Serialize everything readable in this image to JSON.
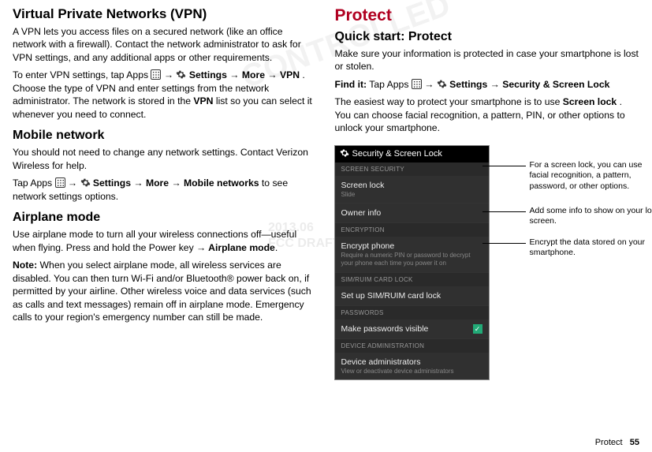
{
  "left": {
    "h_vpn": "Virtual Private Networks (VPN)",
    "p_vpn1": "A VPN lets you access files on a secured network (like an office network with a firewall). Contact the network administrator to ask for VPN settings, and any additional apps or other requirements.",
    "p_vpn2a": "To enter VPN settings, tap Apps ",
    "p_vpn2b": " Settings",
    "p_vpn2c": "More",
    "p_vpn2d": "VPN",
    "p_vpn2e": ". Choose the type of VPN and enter settings from the network administrator. The network is stored in the ",
    "p_vpn2f": "VPN",
    "p_vpn2g": " list so you can select it whenever you need to connect.",
    "h_mobile": "Mobile network",
    "p_mobile1": "You should not need to change any network settings. Contact Verizon Wireless for help.",
    "p_mobile2a": "Tap Apps ",
    "p_mobile2b": " Settings",
    "p_mobile2c": "More",
    "p_mobile2d": "Mobile networks",
    "p_mobile2e": " to see network settings options.",
    "h_airplane": "Airplane mode",
    "p_air1": "Use airplane mode to turn all your wireless connections off—useful when flying. Press and hold the Power key ",
    "p_air1b": "Airplane mode",
    "p_air2a": "Note:",
    "p_air2b": " When you select airplane mode, all wireless services are disabled. You can then turn Wi-Fi and/or Bluetooth® power back on, if permitted by your airline. Other wireless voice and data services (such as calls and text messages) remain off in airplane mode. Emergency calls to your region's emergency number can still be made."
  },
  "right": {
    "h_protect": "Protect",
    "h_quick": "Quick start: Protect",
    "p_quick1": "Make sure your information is protected in case your smartphone is lost or stolen.",
    "findit_label": "Find it:",
    "findit_a": " Tap Apps ",
    "findit_b": " Settings",
    "findit_c": "Security & Screen Lock",
    "p_easiest_a": "The easiest way to protect your smartphone is to use ",
    "p_easiest_b": "Screen lock",
    "p_easiest_c": ". You can choose facial recognition, a pattern, PIN, or other options to unlock your smartphone."
  },
  "phone": {
    "title": "Security & Screen Lock",
    "sec_security": "SCREEN SECURITY",
    "screen_lock": "Screen lock",
    "screen_lock_sub": "Slide",
    "owner_info": "Owner info",
    "sec_encryption": "ENCRYPTION",
    "encrypt_phone": "Encrypt phone",
    "encrypt_phone_sub": "Require a numeric PIN or password to decrypt your phone each time you power it on",
    "sec_sim": "SIM/RUIM CARD LOCK",
    "setup_sim": "Set up SIM/RUIM card lock",
    "sec_passwords": "PASSWORDS",
    "make_pw_visible": "Make passwords visible",
    "sec_device_admin": "DEVICE ADMINISTRATION",
    "device_admins": "Device administrators",
    "device_admins_sub": "View or deactivate device administrators"
  },
  "annots": {
    "a1": "For a screen lock, you can use facial recognition, a pattern, password, or other options.",
    "a2": "Add some info to show on your lock screen.",
    "a3": "Encrypt the data stored on your smartphone."
  },
  "footer": {
    "label": "Protect",
    "page": "55"
  },
  "wm": {
    "contr": "CONTROLLED",
    "date": "2013.06",
    "fcc": "FCC DRAFT"
  }
}
